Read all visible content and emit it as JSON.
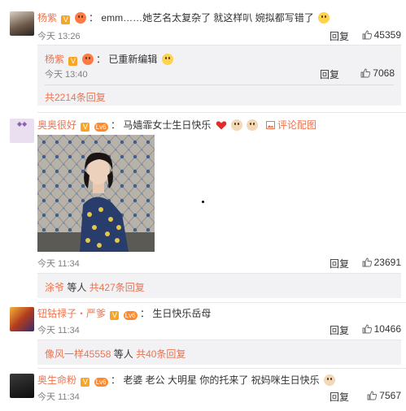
{
  "comments": [
    {
      "user": "杨紫",
      "text": "emm……她艺名太复杂了 就这样叭 婉拟都写错了",
      "time": "今天 13:26",
      "reply": "回复",
      "likes": "45359",
      "subreply": {
        "user": "杨紫",
        "text": "已重新编辑",
        "time": "今天 13:40",
        "reply": "回复",
        "likes": "7068"
      },
      "more": "共2214条回复"
    },
    {
      "user": "奥奥很好",
      "level_badge": "Lv6",
      "text": "马嫱霏女士生日快乐",
      "comment_image_link": "评论配图",
      "time": "今天 11:34",
      "reply": "回复",
      "likes": "23691",
      "replier": "涂爷",
      "etc": "等人",
      "more": "共427条回复"
    },
    {
      "user": "钮钴禄子・严爹",
      "level_badge": "Lv6",
      "text": "生日快乐岳母",
      "time": "今天 11:34",
      "reply": "回复",
      "likes": "10466",
      "replier": "像风一样45558",
      "etc": "等人",
      "more": "共40条回复"
    },
    {
      "user": "奥生命粉",
      "level_badge": "Lv6",
      "text": "老婆 老公 大明星 你的托来了 祝妈咪生日快乐",
      "time": "今天 11:34",
      "reply": "回复",
      "likes": "7567"
    }
  ],
  "colors": {
    "username": "#eb7350",
    "subreply_bg": "#f2f2f5",
    "meta": "#808080"
  },
  "icons": [
    "verified-badge-icon",
    "level-badge-icon",
    "emoji-icon",
    "thumbs-up-icon",
    "image-icon",
    "heart-icon"
  ]
}
